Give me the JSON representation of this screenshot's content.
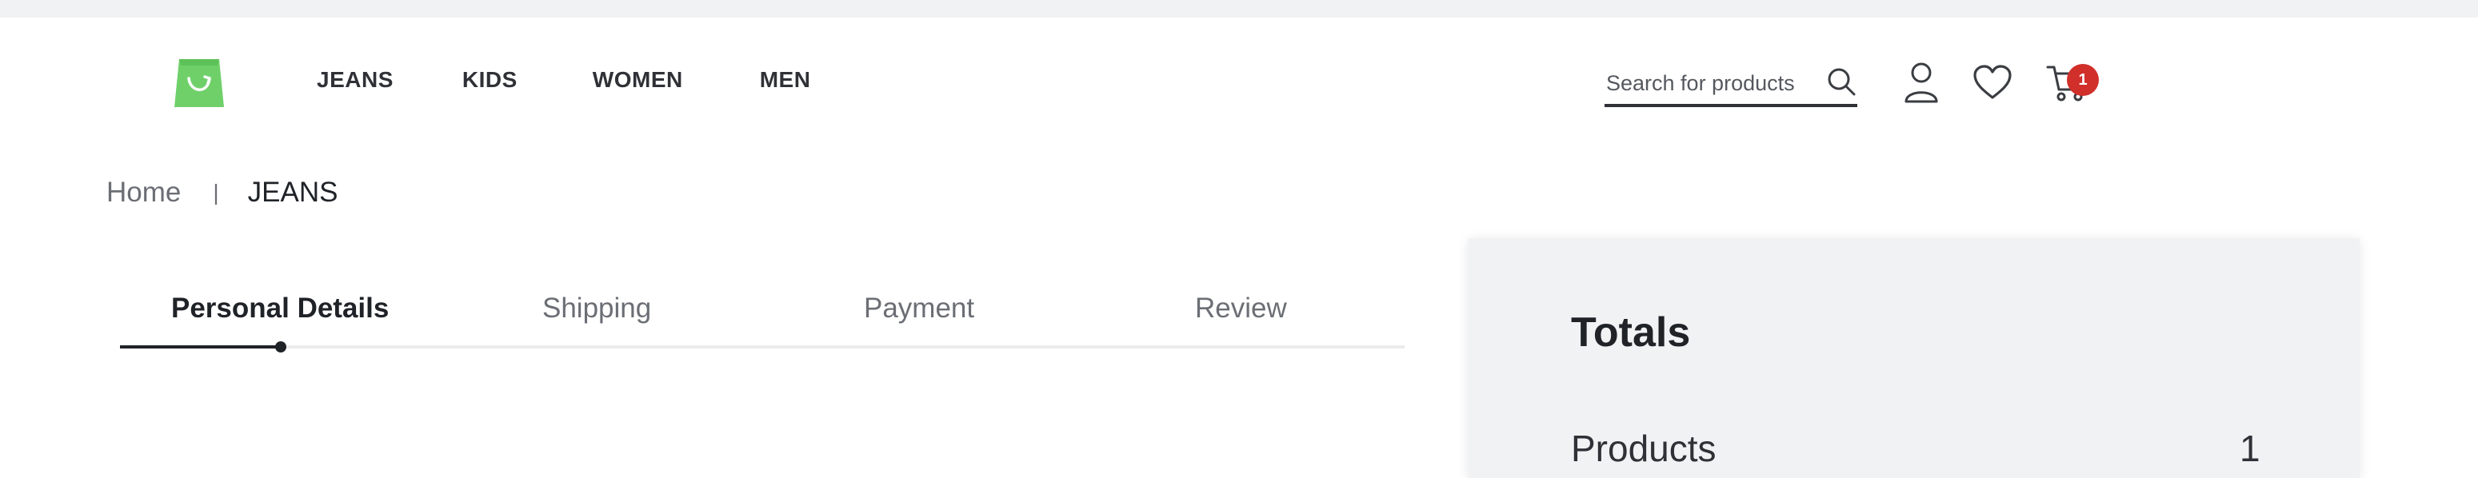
{
  "header": {
    "nav": [
      "JEANS",
      "KIDS",
      "WOMEN",
      "MEN"
    ],
    "search": {
      "placeholder": "Search for products",
      "value": ""
    },
    "cart_count": "1",
    "icons": [
      "shopping-bag-logo-icon",
      "search-icon",
      "user-icon",
      "heart-icon",
      "cart-icon"
    ],
    "colors": {
      "logo": "#6fd06a",
      "badge": "#d12f2a"
    }
  },
  "breadcrumb": {
    "home": "Home",
    "separator": "|",
    "current": "JEANS"
  },
  "checkout_steps": {
    "items": [
      "Personal Details",
      "Shipping",
      "Payment",
      "Review"
    ],
    "active_index": 0
  },
  "totals": {
    "title": "Totals",
    "rows": [
      {
        "label": "Products",
        "value": "1"
      }
    ]
  }
}
